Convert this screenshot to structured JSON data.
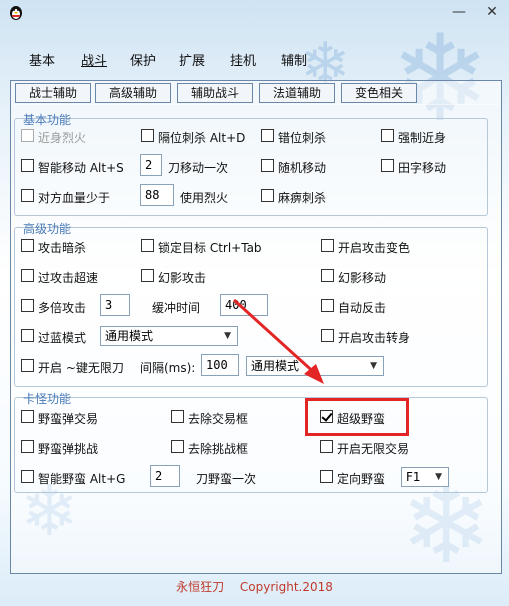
{
  "window": {
    "min": "—",
    "close": "✕"
  },
  "top_tabs": [
    "基本",
    "战斗",
    "保护",
    "扩展",
    "挂机",
    "辅制"
  ],
  "sub_tabs": [
    "战士辅助",
    "高级辅助",
    "辅助战斗",
    "法道辅助",
    "变色相关"
  ],
  "basic": {
    "title": "基本功能",
    "r1": {
      "a": "近身烈火",
      "b": "隔位刺杀 Alt+D",
      "c": "错位刺杀",
      "d": "强制近身"
    },
    "r2": {
      "a": "智能移动 Alt+S",
      "a_val": "2",
      "a_suffix": "刀移动一次",
      "c": "随机移动",
      "d": "田字移动"
    },
    "r3": {
      "a": "对方血量少于",
      "a_val": "88",
      "a_suffix": "使用烈火",
      "c": "麻痹刺杀"
    }
  },
  "advanced": {
    "title": "高级功能",
    "r1": {
      "a": "攻击暗杀",
      "b": "锁定目标 Ctrl+Tab",
      "c": "开启攻击变色"
    },
    "r2": {
      "a": "过攻击超速",
      "b": "幻影攻击",
      "c": "幻影移动"
    },
    "r3": {
      "a": "多倍攻击",
      "a_val": "3",
      "b": "缓冲时间",
      "b_val": "400",
      "c": "自动反击"
    },
    "r4": {
      "a": "过蓝模式",
      "select": "通用模式",
      "c": "开启攻击转身"
    },
    "r5": {
      "a": "开启 ~键无限刀",
      "b": "间隔(ms):",
      "b_val": "100",
      "select": "通用模式"
    }
  },
  "card": {
    "title": "卡怪功能",
    "r1": {
      "a": "野蛮弹交易",
      "b": "去除交易框",
      "c": "超级野蛮"
    },
    "r2": {
      "a": "野蛮弹挑战",
      "b": "去除挑战框",
      "c": "开启无限交易"
    },
    "r3": {
      "a": "智能野蛮 Alt+G",
      "a_val": "2",
      "a_suffix": "刀野蛮一次",
      "c": "定向野蛮",
      "select": "F1"
    }
  },
  "footer": {
    "name": "永恒狂刀",
    "copyright": "Copyright.2018"
  },
  "colors": {
    "highlight": "#e32525",
    "group_title": "#4a7bb7",
    "footer": "#c0392b"
  }
}
